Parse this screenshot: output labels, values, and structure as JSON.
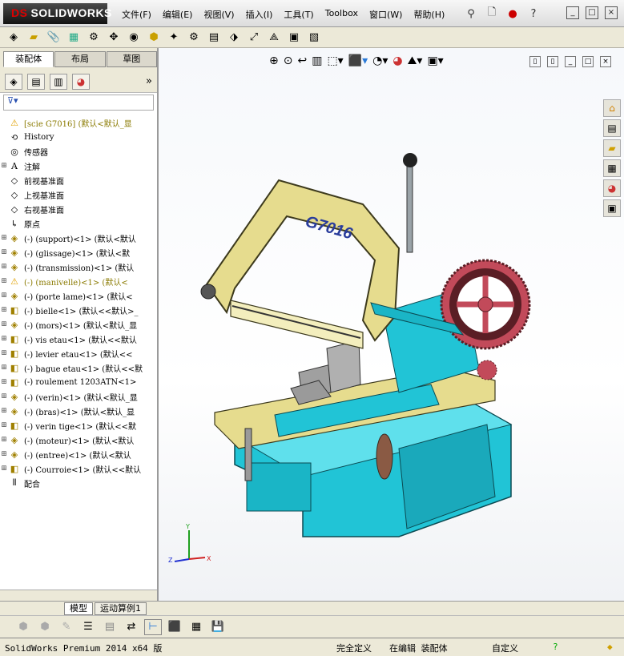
{
  "app": {
    "logo_prefix": "DS",
    "logo_text": "SOLIDWORKS"
  },
  "menu": [
    "文件(F)",
    "编辑(E)",
    "视图(V)",
    "插入(I)",
    "工具(T)",
    "Toolbox",
    "窗口(W)",
    "帮助(H)"
  ],
  "tabs": {
    "assembly": "装配体",
    "layout": "布局",
    "sketch": "草图"
  },
  "tree": [
    {
      "t": "[scie G7016]  (默认<默认_显",
      "type": "root"
    },
    {
      "t": "History",
      "type": "history"
    },
    {
      "t": "传感器",
      "type": "sensor"
    },
    {
      "t": "注解",
      "type": "annot",
      "exp": true
    },
    {
      "t": "前视基准面",
      "type": "plane"
    },
    {
      "t": "上视基准面",
      "type": "plane"
    },
    {
      "t": "右视基准面",
      "type": "plane"
    },
    {
      "t": "原点",
      "type": "origin"
    },
    {
      "t": "(-) (support)<1> (默认<默认",
      "type": "part",
      "exp": true
    },
    {
      "t": "(-) (glissage)<1> (默认<默",
      "type": "part",
      "exp": true
    },
    {
      "t": "(-) (transmission)<1> (默认",
      "type": "part",
      "exp": true
    },
    {
      "t": "(-) (manivelle)<1> (默认<",
      "type": "warnpart",
      "exp": true
    },
    {
      "t": "(-) (porte lame)<1> (默认<",
      "type": "part",
      "exp": true
    },
    {
      "t": "(-) bielle<1> (默认<<默认>_",
      "type": "sub",
      "exp": true
    },
    {
      "t": "(-) (mors)<1> (默认<默认_显",
      "type": "part",
      "exp": true
    },
    {
      "t": "(-) vis etau<1> (默认<<默认",
      "type": "sub",
      "exp": true
    },
    {
      "t": "(-) levier etau<1> (默认<<",
      "type": "sub",
      "exp": true
    },
    {
      "t": "(-) bague etau<1> (默认<<默",
      "type": "sub",
      "exp": true
    },
    {
      "t": "(-) roulement 1203ATN<1>",
      "type": "sub",
      "exp": true
    },
    {
      "t": "(-) (verin)<1> (默认<默认_显",
      "type": "part",
      "exp": true
    },
    {
      "t": "(-) (bras)<1> (默认<默认_显",
      "type": "part",
      "exp": true
    },
    {
      "t": "(-) verin tige<1> (默认<<默",
      "type": "sub",
      "exp": true
    },
    {
      "t": "(-) (moteur)<1> (默认<默认",
      "type": "part",
      "exp": true
    },
    {
      "t": "(-) (entree)<1> (默认<默认",
      "type": "part",
      "exp": true
    },
    {
      "t": "(-) Courroie<1> (默认<<默认",
      "type": "sub",
      "exp": true
    },
    {
      "t": "配合",
      "type": "mate"
    }
  ],
  "bottom_tabs": [
    "模型",
    "运动算例1"
  ],
  "status": {
    "product": "SolidWorks Premium 2014 x64 版",
    "constraint": "完全定义",
    "mode": "在编辑 装配体",
    "custom": "自定义"
  },
  "model": {
    "label": "G7016",
    "colors": {
      "base": "#21c4d6",
      "frame": "#e6dc8e",
      "wheel": "#c24a5a",
      "vise": "#a0a0a0"
    }
  }
}
